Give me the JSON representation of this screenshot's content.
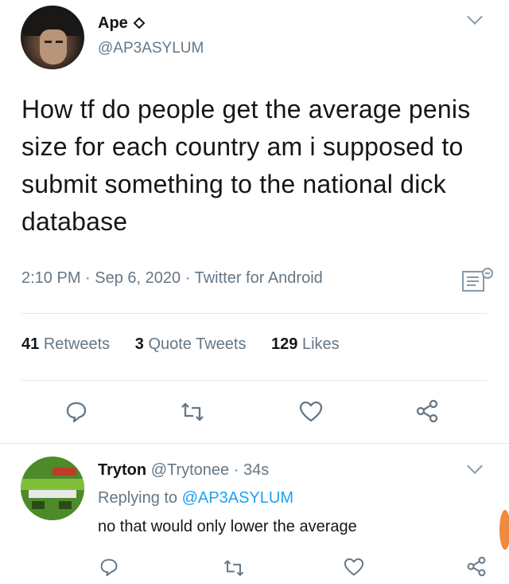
{
  "tweet": {
    "author_name": "Ape",
    "author_handle": "@AP3ASYLUM",
    "text": "How tf do people get the average penis size for each country am i supposed to submit something to the national dick database",
    "time": "2:10 PM",
    "date": "Sep 6, 2020",
    "source": "Twitter for Android",
    "separator": "·",
    "stats": {
      "retweets_count": "41",
      "retweets_label": "Retweets",
      "quotes_count": "3",
      "quotes_label": "Quote Tweets",
      "likes_count": "129",
      "likes_label": "Likes"
    }
  },
  "reply": {
    "author_name": "Tryton",
    "author_handle": "@Trytonee",
    "time": "34s",
    "replying_prefix": "Replying to",
    "replying_handle": "@AP3ASYLUM",
    "text": "no that would only lower the average"
  },
  "icons": {
    "verified_like": "diamond-outline-icon",
    "menu": "chevron-down-icon",
    "analytics": "analytics-icon",
    "reply": "comment-bubble-icon",
    "retweet": "retweet-icon",
    "like": "heart-icon",
    "share": "share-icon"
  },
  "colors": {
    "text": "#14171a",
    "muted": "#657786",
    "link": "#1da1f2",
    "divider": "#e1e8ed"
  }
}
